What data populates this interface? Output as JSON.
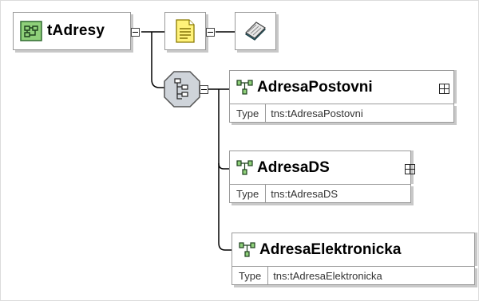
{
  "root": {
    "label": "tAdresy"
  },
  "elements": [
    {
      "name": "AdresaPostovni",
      "type_key": "Type",
      "type_value": "tns:tAdresaPostovni"
    },
    {
      "name": "AdresaDS",
      "type_key": "Type",
      "type_value": "tns:tAdresaDS"
    },
    {
      "name": "AdresaElektronicka",
      "type_key": "Type",
      "type_value": "tns:tAdresaElektronicka"
    }
  ],
  "icons": {
    "root": "complex-type-icon",
    "annotation": "annotation-icon",
    "documentation": "documentation-icon",
    "compositor": "sequence-compositor-icon",
    "element": "element-icon",
    "expand": "expand-plus-icon"
  }
}
